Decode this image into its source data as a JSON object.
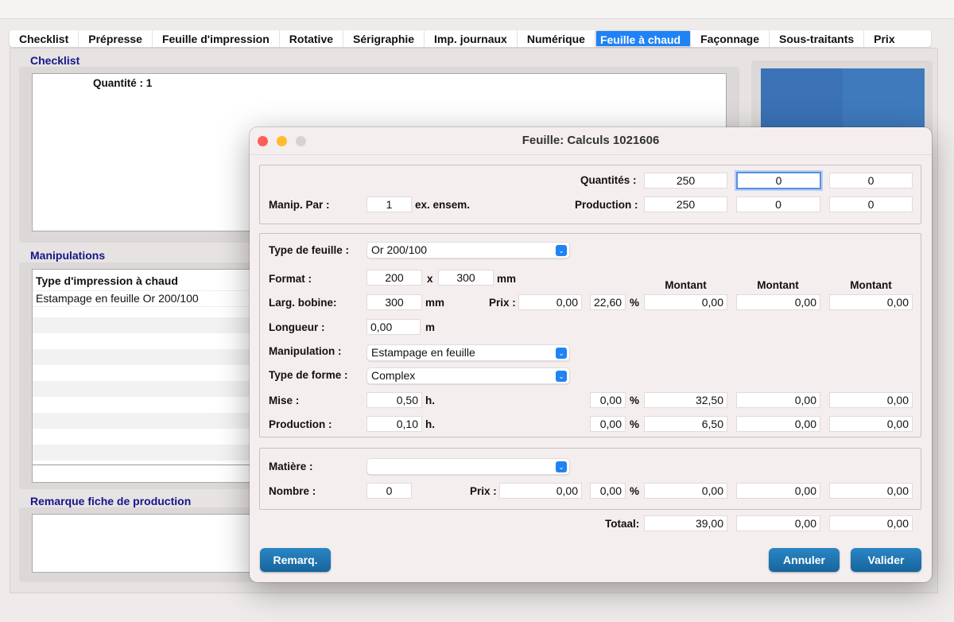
{
  "tabs": [
    "Checklist",
    "Prépresse",
    "Feuille d'impression",
    "Rotative",
    "Sérigraphie",
    "Imp. journaux",
    "Numérique",
    "Feuille à chaud",
    "Façonnage",
    "Sous-traitants",
    "Prix"
  ],
  "selected_tab": "Feuille à chaud",
  "checklist": {
    "title": "Checklist",
    "content": "Quantité : 1"
  },
  "manipulations": {
    "title": "Manipulations",
    "header": "Type d'impression à chaud",
    "rows": [
      "Estampage en feuille Or 200/100"
    ]
  },
  "remarque": {
    "title": "Remarque fiche de production"
  },
  "dialog": {
    "title": "Feuille: Calculs 1021606",
    "quantites_label": "Quantités :",
    "quantites": [
      "250",
      "0",
      "0"
    ],
    "manip_par_label": "Manip. Par :",
    "manip_par": "1",
    "manip_par_unit": "ex. ensem.",
    "production_label": "Production :",
    "production": [
      "250",
      "0",
      "0"
    ],
    "type_feuille_label": "Type de feuille :",
    "type_feuille": "Or 200/100",
    "format_label": "Format :",
    "format_w": "200",
    "format_x": "x",
    "format_h": "300",
    "mm": "mm",
    "montant_label": "Montant",
    "larg_label": "Larg. bobine:",
    "larg": "300",
    "prix_label": "Prix :",
    "prix": "0,00",
    "prix_pct": "22,60",
    "pct": "%",
    "prix_montants": [
      "0,00",
      "0,00",
      "0,00"
    ],
    "longueur_label": "Longueur :",
    "longueur": "0,00",
    "m": "m",
    "manipulation_label": "Manipulation :",
    "manipulation": "Estampage en feuille",
    "type_forme_label": "Type de forme :",
    "type_forme": "Complex",
    "mise_label": "Mise :",
    "mise": "0,50",
    "h": "h.",
    "mise_pct": "0,00",
    "mise_montants": [
      "32,50",
      "0,00",
      "0,00"
    ],
    "prod_label": "Production :",
    "prod": "0,10",
    "prod_pct": "0,00",
    "prod_montants": [
      "6,50",
      "0,00",
      "0,00"
    ],
    "matiere_label": "Matière :",
    "matiere": "",
    "nombre_label": "Nombre :",
    "nombre": "0",
    "mat_prix": "0,00",
    "mat_pct": "0,00",
    "mat_montants": [
      "0,00",
      "0,00",
      "0,00"
    ],
    "totaal_label": "Totaal:",
    "totaal": [
      "39,00",
      "0,00",
      "0,00"
    ],
    "remarq": "Remarq.",
    "annuler": "Annuler",
    "valider": "Valider"
  },
  "colors": {
    "accent": "#1f82f5",
    "button": "#1a6fa8",
    "section_title": "#15158a"
  }
}
